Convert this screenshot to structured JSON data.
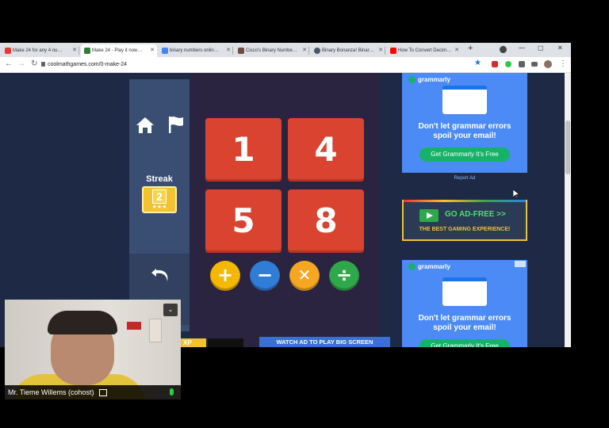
{
  "browser": {
    "tabs": [
      {
        "label": "Make 24 for any 4 nu…",
        "active": false,
        "favicon_color": "#e53935"
      },
      {
        "label": "Make 24 - Play it now…",
        "active": true,
        "favicon_color": "#2e7d32"
      },
      {
        "label": "binary numbers onlin…",
        "active": false,
        "favicon_color": "#4285f4"
      },
      {
        "label": "Cisco's Binary Numbe…",
        "active": false,
        "favicon_color": "#6d4c41"
      },
      {
        "label": "Binary Bonanza! Binar…",
        "active": false,
        "favicon_color": "#455a64"
      },
      {
        "label": "How To Convert Decim…",
        "active": false,
        "favicon_color": "#ff0000"
      }
    ],
    "new_tab_label": "+",
    "url": "coolmathgames.com/0-make-24",
    "window_controls": [
      "—",
      "▢",
      "✕"
    ]
  },
  "game": {
    "streak_label": "Streak",
    "streak_value": "2",
    "streak_stars": "★★★",
    "tiles": [
      "1",
      "4",
      "5",
      "8"
    ],
    "operators": [
      {
        "symbol": "+",
        "name": "plus",
        "color": "#f5b800"
      },
      {
        "symbol": "−",
        "name": "minus",
        "color": "#2f7dd6"
      },
      {
        "symbol": "✕",
        "name": "times",
        "color": "#f5a623"
      },
      {
        "symbol": "÷",
        "name": "divide",
        "color": "#2ea84a"
      }
    ],
    "xp_label": "XP",
    "watch_ad_label": "WATCH AD TO PLAY BIG SCREEN"
  },
  "ads": {
    "brand": "grammarly",
    "headline_line1": "Don't let grammar errors",
    "headline_line2": "spoil your email!",
    "cta": "Get Grammarly  It's Free",
    "report_ad": "Report Ad",
    "adfree_title": "GO AD-FREE >>",
    "adfree_sub": "THE BEST GAMING EXPERIENCE!"
  },
  "video_call": {
    "participant_name": "Mr. Tieme Willems (cohost)",
    "mic_color": "#2ecc40"
  },
  "colors": {
    "page_bg": "#1e2a45",
    "tile": "#d9432f",
    "sidebar": "#3a4d73",
    "ad_blue": "#4c8bf5",
    "cta_green": "#17b26a"
  }
}
